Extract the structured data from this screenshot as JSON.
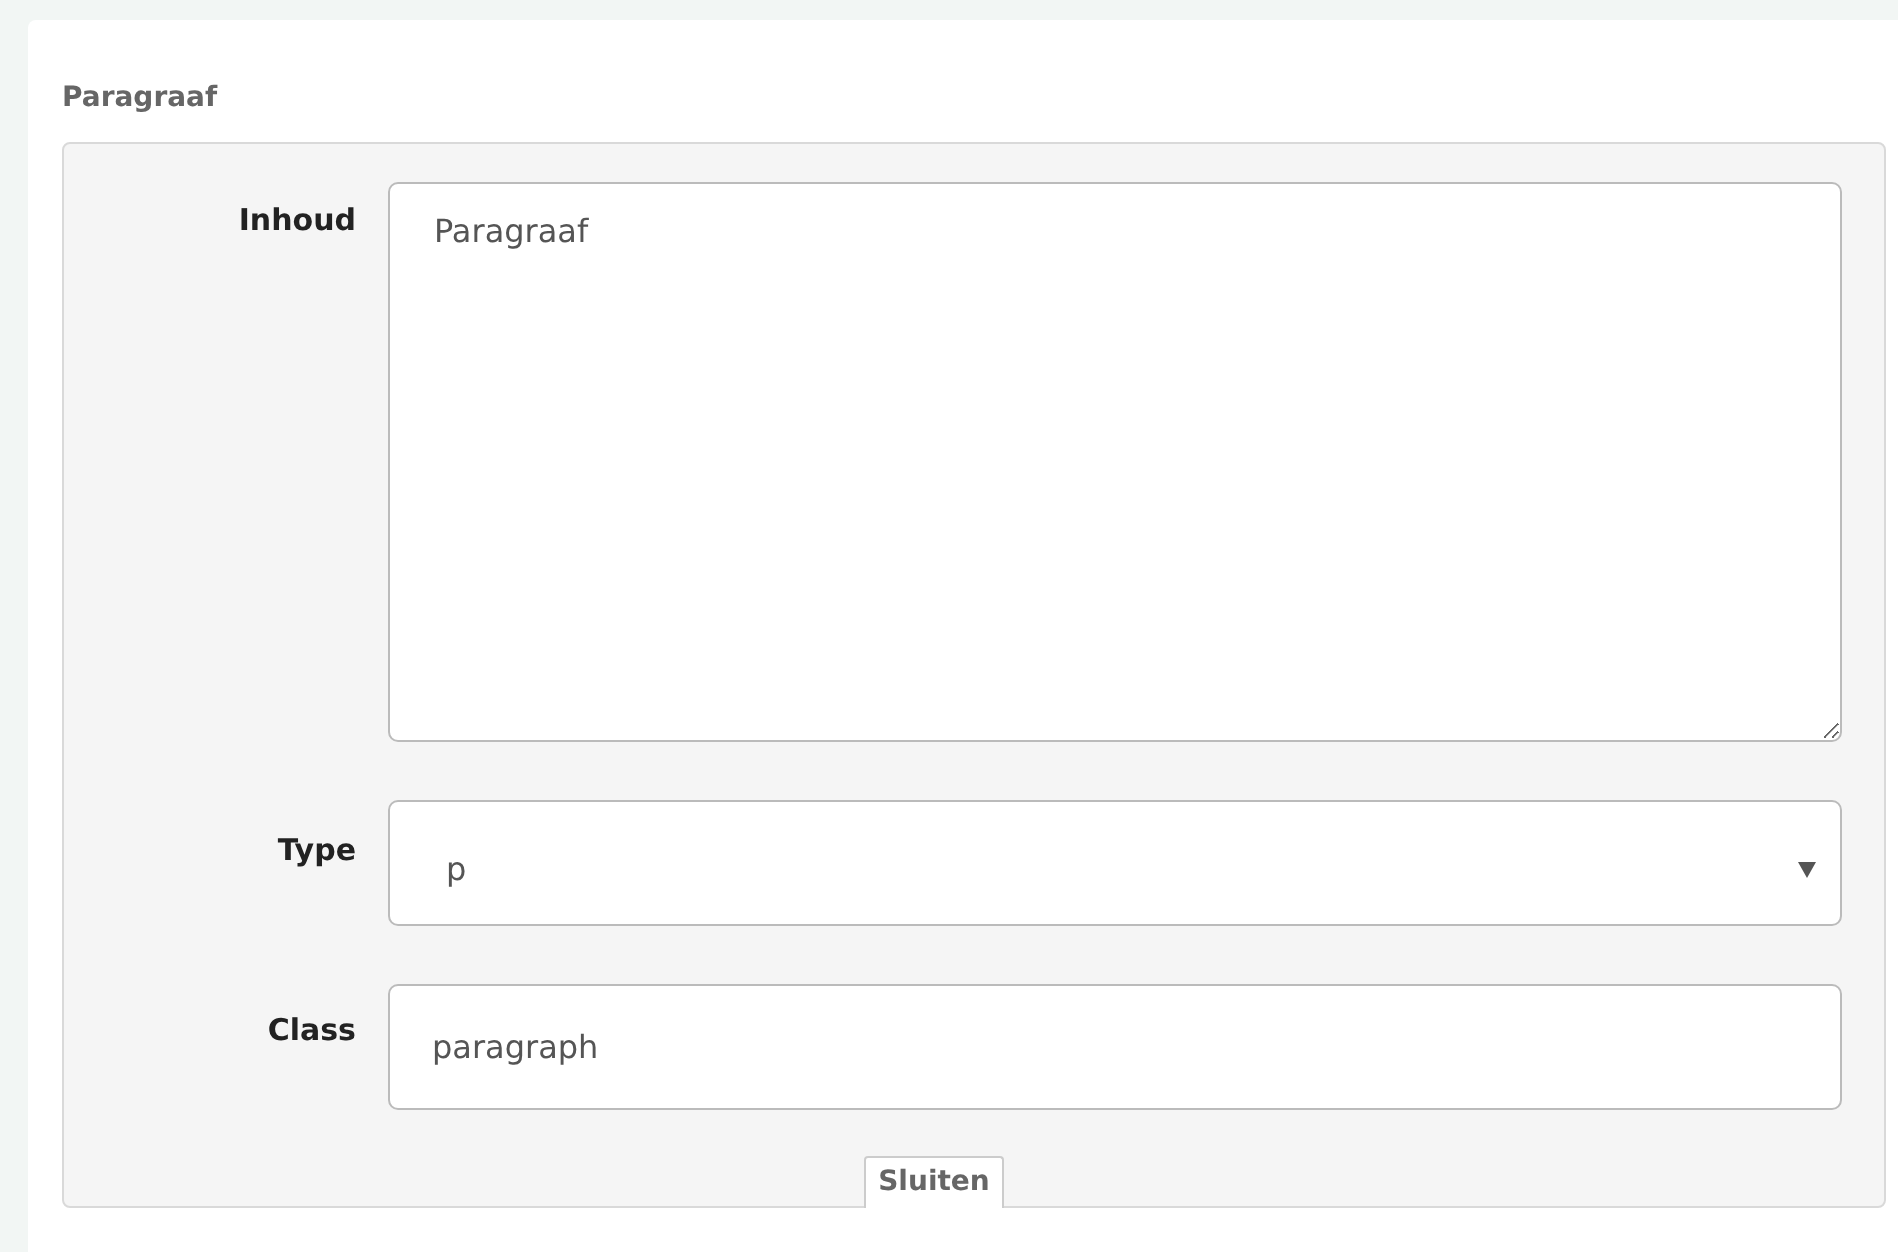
{
  "panel": {
    "title": "Paragraaf"
  },
  "fields": [
    {
      "kind": "textarea",
      "label": "Inhoud",
      "value": "Paragraaf"
    },
    {
      "kind": "select",
      "label": "Type",
      "value": "p"
    },
    {
      "kind": "text",
      "label": "Class",
      "value": "paragraph"
    }
  ],
  "close_button": "Sluiten"
}
